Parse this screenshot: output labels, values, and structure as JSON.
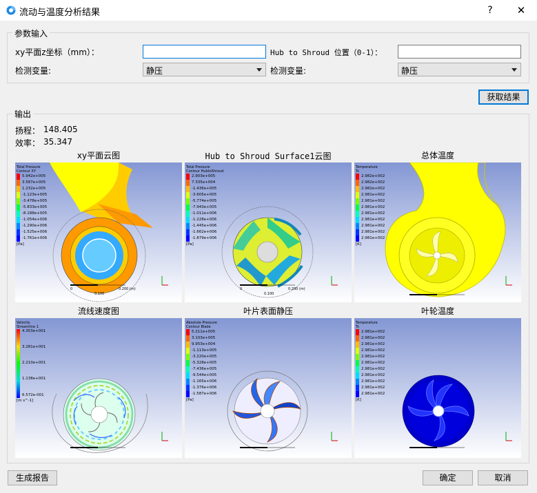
{
  "window": {
    "title": "流动与温度分析结果",
    "help": "?",
    "close": "✕"
  },
  "params": {
    "group_title": "参数输入",
    "xy_label": "xy平面z坐标（mm）：",
    "xy_value": "",
    "hub_label": "Hub to Shroud 位置（0-1）：",
    "hub_value": "",
    "var1_label": "检测变量:",
    "var1_value": "静压",
    "var2_label": "检测变量:",
    "var2_value": "静压"
  },
  "get_button": "获取结果",
  "output": {
    "group_title": "输出",
    "head_label": "扬程：",
    "head_value": "148.405",
    "eff_label": "效率：",
    "eff_value": "35.347"
  },
  "images": [
    {
      "title": "xy平面云图",
      "legend_title": "Total Pressure",
      "legend_sub": "Contour XY",
      "values": [
        "5.942e+005",
        "3.587e+005",
        "1.232e+005",
        "-1.123e+005",
        "-3.478e+005",
        "-5.833e+005",
        "-8.188e+005",
        "-1.054e+006",
        "-1.290e+006",
        "-1.525e+006",
        "-1.761e+006"
      ],
      "unit": "[Pa]"
    },
    {
      "title": "Hub to Shroud Surface1云图",
      "legend_title": "Total Pressure",
      "legend_sub": "Contour HubtoShroud",
      "values": [
        "2.903e+005",
        "7.335e+004",
        "-1.436e+005",
        "-3.605e+005",
        "-5.774e+005",
        "-7.943e+005",
        "-1.011e+006",
        "-1.228e+006",
        "-1.445e+006",
        "-1.662e+006",
        "-1.879e+006"
      ],
      "unit": "[Pa]"
    },
    {
      "title": "总体温度",
      "legend_title": "Temperature",
      "legend_sub": "Ts",
      "values": [
        "2.982e+002",
        "2.982e+002",
        "2.982e+002",
        "2.981e+002",
        "2.981e+002",
        "2.981e+002",
        "2.981e+002",
        "2.981e+002",
        "2.981e+002",
        "2.981e+002",
        "2.981e+002"
      ],
      "unit": "[K]"
    },
    {
      "title": "流线速度图",
      "legend_title": "Velocity",
      "legend_sub": "Streamline 1",
      "values": [
        "4.353e+001",
        "3.281e+001",
        "2.210e+001",
        "1.138e+001",
        "6.572e-001"
      ],
      "unit": "[m s^-1]"
    },
    {
      "title": "叶片表面静压",
      "legend_title": "Absolute Pressure",
      "legend_sub": "Contour Blade",
      "values": [
        "5.211e+005",
        "3.103e+005",
        "9.953e+004",
        "-1.113e+005",
        "-3.220e+005",
        "-5.328e+005",
        "-7.436e+005",
        "-9.544e+005",
        "-1.165e+006",
        "-1.376e+006",
        "-1.587e+006"
      ],
      "unit": "[Pa]"
    },
    {
      "title": "叶轮温度",
      "legend_title": "Temperature",
      "legend_sub": "Ts",
      "values": [
        "2.981e+002",
        "2.981e+002",
        "2.981e+002",
        "2.981e+002",
        "2.981e+002",
        "2.981e+002",
        "2.981e+002",
        "2.981e+002",
        "2.981e+002",
        "2.981e+002",
        "2.981e+002"
      ],
      "unit": "[K]"
    }
  ],
  "scale": {
    "zero": "0",
    "end": "0.200 (m)",
    "mid": "0.100"
  },
  "footer": {
    "report": "生成报告",
    "ok": "确定",
    "cancel": "取消"
  },
  "legend_colors": [
    "#ff0000",
    "#ff6600",
    "#ffbb00",
    "#ddff00",
    "#77ff00",
    "#00ff44",
    "#00ffbb",
    "#00ddff",
    "#0088ff",
    "#0033ff",
    "#0000ff"
  ],
  "accent_color": "#0078d7"
}
